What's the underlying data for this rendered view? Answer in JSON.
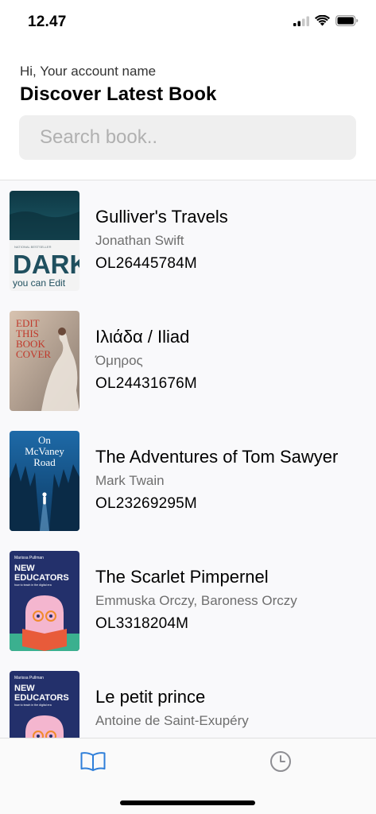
{
  "status": {
    "time": "12.47"
  },
  "header": {
    "greeting": "Hi, Your account name",
    "title": "Discover Latest Book"
  },
  "search": {
    "placeholder": "Search book.."
  },
  "books": [
    {
      "title": "Gulliver's Travels",
      "author": "Jonathan Swift",
      "key": "OL26445784M",
      "cover_icon": "dark-forest-cover",
      "cover_text": [
        "DARK",
        "you can Edit"
      ]
    },
    {
      "title": "Ιλιάδα / Iliad",
      "author": "Όμηρος",
      "key": "OL24431676M",
      "cover_icon": "edit-this-book-cover",
      "cover_text": [
        "EDIT",
        "THIS",
        "BOOK",
        "COVER"
      ]
    },
    {
      "title": "The Adventures of Tom Sawyer",
      "author": "Mark Twain",
      "key": "OL23269295M",
      "cover_icon": "mcvaney-road-cover",
      "cover_text": [
        "On",
        "McVaney",
        "Road"
      ]
    },
    {
      "title": "The Scarlet Pimpernel",
      "author": "Emmuska Orczy, Baroness Orczy",
      "key": "OL3318204M",
      "cover_icon": "new-educators-cover",
      "cover_text": [
        "Marissa Pullman",
        "NEW",
        "EDUCATORS",
        "how to teach in the digital era"
      ]
    },
    {
      "title": "Le petit prince",
      "author": "Antoine de Saint-Exupéry",
      "key": "",
      "cover_icon": "new-educators-cover",
      "cover_text": [
        "Marissa Pullman",
        "NEW",
        "EDUCATORS",
        "how to teach in the digital era"
      ]
    }
  ],
  "tabbar": {
    "tabs": [
      {
        "icon": "book-open-icon",
        "active": true
      },
      {
        "icon": "clock-icon",
        "active": false
      }
    ],
    "active_color": "#2f7fd9",
    "inactive_color": "#8e8e93"
  }
}
